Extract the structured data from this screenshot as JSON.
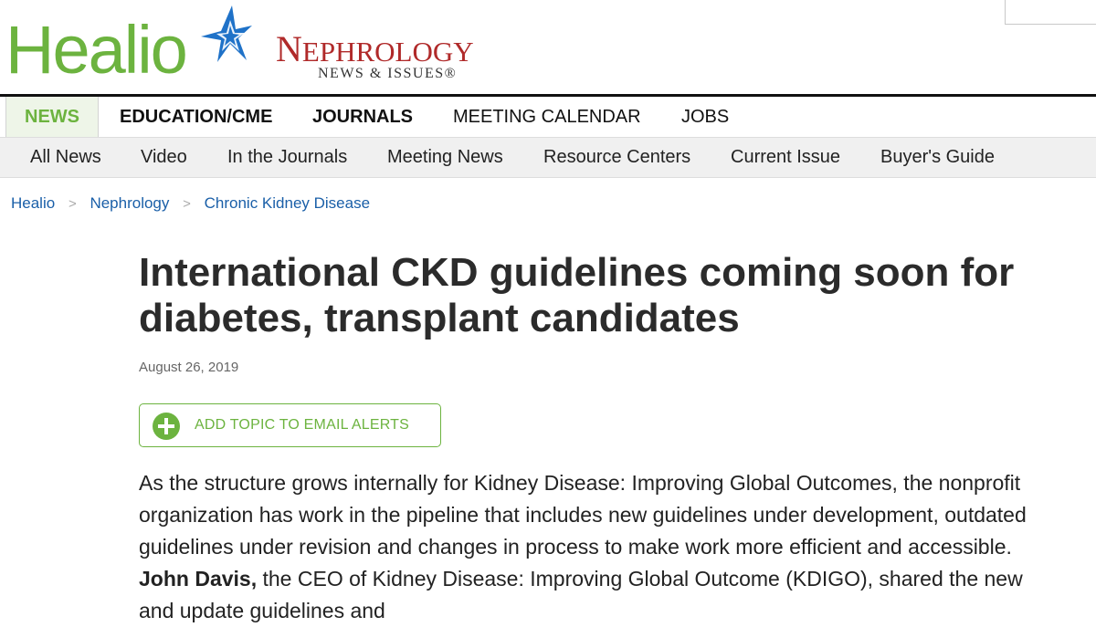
{
  "brand": {
    "healio": "Healio",
    "nephrology_first": "N",
    "nephrology_rest": "EPHROLOGY",
    "subtitle": "NEWS & ISSUES®"
  },
  "nav_main": {
    "active": "NEWS",
    "items": [
      "EDUCATION/CME",
      "JOURNALS",
      "MEETING CALENDAR",
      "JOBS"
    ]
  },
  "nav_sub": {
    "items": [
      "All News",
      "Video",
      "In the Journals",
      "Meeting News",
      "Resource Centers",
      "Current Issue",
      "Buyer's Guide"
    ]
  },
  "breadcrumb": {
    "items": [
      "Healio",
      "Nephrology",
      "Chronic Kidney Disease"
    ],
    "separator": ">"
  },
  "article": {
    "title": "International CKD guidelines coming soon for diabetes, transplant candidates",
    "date": "August 26, 2019",
    "alert_button": "ADD TOPIC TO EMAIL ALERTS",
    "body_part1": "As the structure grows internally for Kidney Disease: Improving Global Outcomes, the nonprofit organization has work in the pipeline that includes new guidelines under development, outdated guidelines under revision and changes in process to make work more efficient and accessible. ",
    "body_bold": "John Davis,",
    "body_part2": " the CEO of Kidney Disease: Improving Global Outcome (KDIGO), shared the new and update guidelines and"
  },
  "colors": {
    "brand_green": "#6cb33f",
    "brand_red": "#b02a2a",
    "link_blue": "#1a5fa8",
    "star_blue": "#1f72c8"
  },
  "icons": {
    "logo_star": "star-icon",
    "alert_plus": "plus-circle-icon"
  }
}
